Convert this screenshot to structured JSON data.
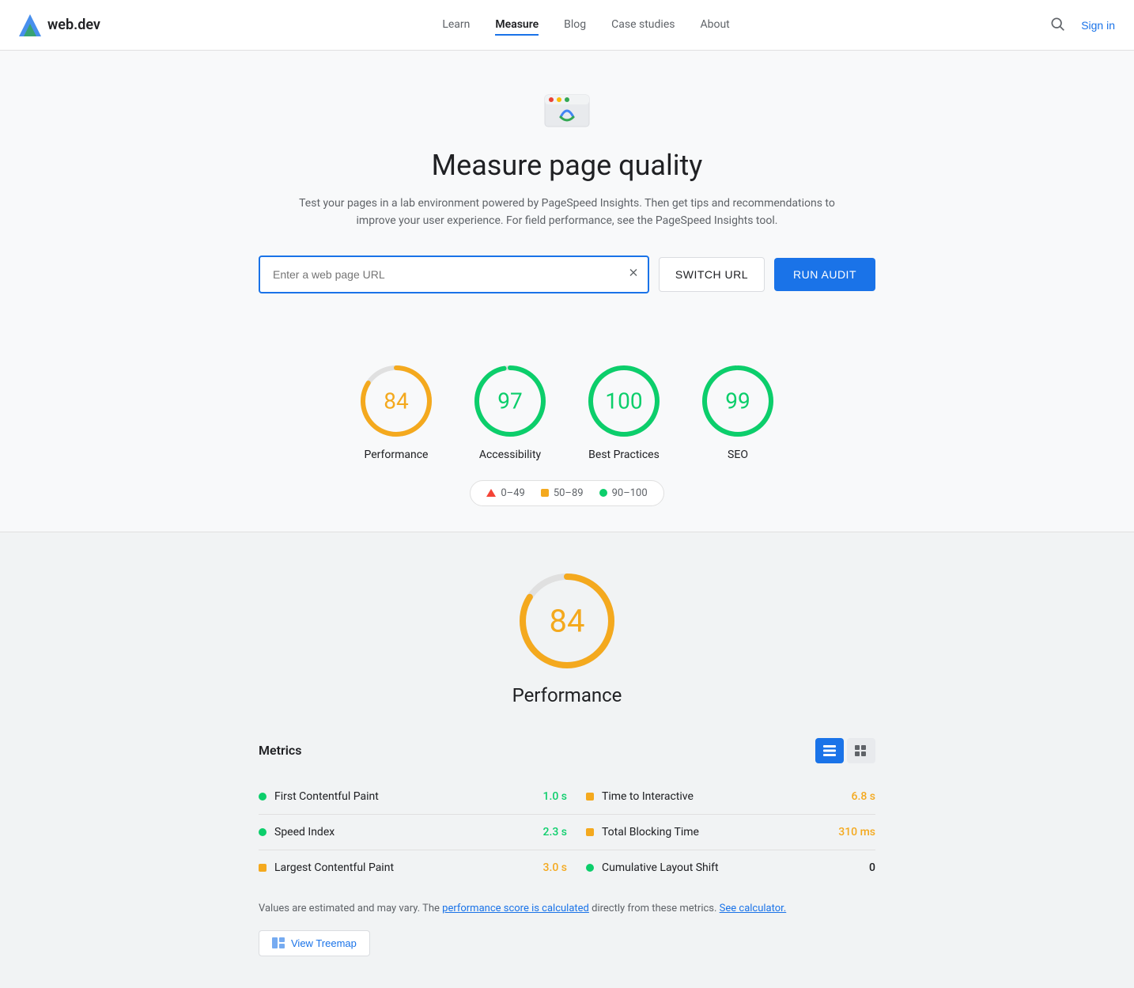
{
  "nav": {
    "logo_text": "web.dev",
    "links": [
      {
        "label": "Learn",
        "active": false
      },
      {
        "label": "Measure",
        "active": true
      },
      {
        "label": "Blog",
        "active": false
      },
      {
        "label": "Case studies",
        "active": false
      },
      {
        "label": "About",
        "active": false
      }
    ],
    "sign_in": "Sign in"
  },
  "hero": {
    "title": "Measure page quality",
    "description": "Test your pages in a lab environment powered by PageSpeed Insights. Then get tips and recommendations to improve your user experience. For field performance, see the PageSpeed Insights tool."
  },
  "url_bar": {
    "placeholder": "Enter a web page URL",
    "switch_url": "SWITCH URL",
    "run_audit": "RUN AUDIT"
  },
  "scores": [
    {
      "value": 84,
      "label": "Performance",
      "color": "#f4a91e",
      "percent": 84
    },
    {
      "value": 97,
      "label": "Accessibility",
      "color": "#0cce6b",
      "percent": 97
    },
    {
      "value": 100,
      "label": "Best Practices",
      "color": "#0cce6b",
      "percent": 100
    },
    {
      "value": 99,
      "label": "SEO",
      "color": "#0cce6b",
      "percent": 99
    }
  ],
  "legend": {
    "items": [
      {
        "type": "triangle",
        "range": "0–49",
        "color": "#f44336"
      },
      {
        "type": "square",
        "range": "50–89",
        "color": "#f4a91e"
      },
      {
        "type": "dot",
        "range": "90–100",
        "color": "#0cce6b"
      }
    ]
  },
  "performance": {
    "score": 84,
    "title": "Performance",
    "metrics_title": "Metrics",
    "metrics": [
      {
        "name": "First Contentful Paint",
        "value": "1.0 s",
        "color_type": "green",
        "indicator": "dot"
      },
      {
        "name": "Time to Interactive",
        "value": "6.8 s",
        "color_type": "orange",
        "indicator": "square"
      },
      {
        "name": "Speed Index",
        "value": "2.3 s",
        "color_type": "green",
        "indicator": "dot"
      },
      {
        "name": "Total Blocking Time",
        "value": "310 ms",
        "color_type": "orange",
        "indicator": "square"
      },
      {
        "name": "Largest Contentful Paint",
        "value": "3.0 s",
        "color_type": "orange",
        "indicator": "square"
      },
      {
        "name": "Cumulative Layout Shift",
        "value": "0",
        "color_type": "green",
        "indicator": "dot"
      }
    ],
    "disclaimer": "Values are estimated and may vary. The ",
    "disclaimer_link1": "performance score is calculated",
    "disclaimer_mid": " directly from these metrics. ",
    "disclaimer_link2": "See calculator.",
    "view_treemap": "View Treemap"
  }
}
